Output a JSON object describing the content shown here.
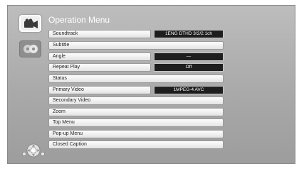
{
  "menu": {
    "title": "Operation Menu",
    "items": [
      {
        "label": "Soundtrack",
        "value": "1ENG DTHD 3/2/2.1ch"
      },
      {
        "label": "Subtitle"
      },
      {
        "label": "Angle",
        "value": "—"
      },
      {
        "label": "Repeat Play",
        "value": "Off"
      },
      {
        "label": "Status"
      },
      {
        "label": "Primary Video",
        "value": "1MPEG-4 AVC"
      },
      {
        "label": "Secondary Video"
      },
      {
        "label": "Zoom"
      },
      {
        "label": "Top Menu"
      },
      {
        "label": "Pop-up Menu"
      },
      {
        "label": "Closed Caption"
      }
    ]
  },
  "side_icons": [
    {
      "icon": "video-camera-icon",
      "state": "selected"
    },
    {
      "icon": "audio-icon",
      "state": "unselected"
    }
  ],
  "hint": {
    "icon": "remote-navigation-icon"
  },
  "colors": {
    "screen_bg": "#a9a9a9",
    "label_bg": "#f0f0f0",
    "value_bg": "#1e1e1e",
    "title_text": "#ffffff"
  }
}
